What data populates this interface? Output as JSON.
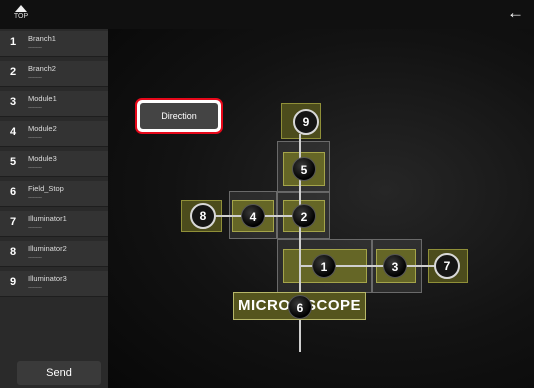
{
  "header": {
    "top_label": "TOP",
    "back_icon": "←"
  },
  "sidebar": {
    "items": [
      {
        "num": "1",
        "label": "Branch1",
        "value": "---------"
      },
      {
        "num": "2",
        "label": "Branch2",
        "value": "---------"
      },
      {
        "num": "3",
        "label": "Module1",
        "value": "---------"
      },
      {
        "num": "4",
        "label": "Module2",
        "value": "---------"
      },
      {
        "num": "5",
        "label": "Module3",
        "value": "---------"
      },
      {
        "num": "6",
        "label": "Field_Stop",
        "value": "---------"
      },
      {
        "num": "7",
        "label": "Illuminator1",
        "value": "---------"
      },
      {
        "num": "8",
        "label": "Illuminator2",
        "value": "---------"
      },
      {
        "num": "9",
        "label": "Illuminator3",
        "value": "---------"
      }
    ],
    "send_label": "Send"
  },
  "main": {
    "direction_label": "Direction",
    "nodes": {
      "n1": "1",
      "n2": "2",
      "n3": "3",
      "n4": "4",
      "n5": "5",
      "n6": "6",
      "n7": "7",
      "n8": "8",
      "n9": "9"
    },
    "scope_left": "MICRO",
    "scope_right": "SCOPE"
  },
  "colors": {
    "accent_red": "#e6081a",
    "olive": "#656626",
    "background": "#121212"
  }
}
